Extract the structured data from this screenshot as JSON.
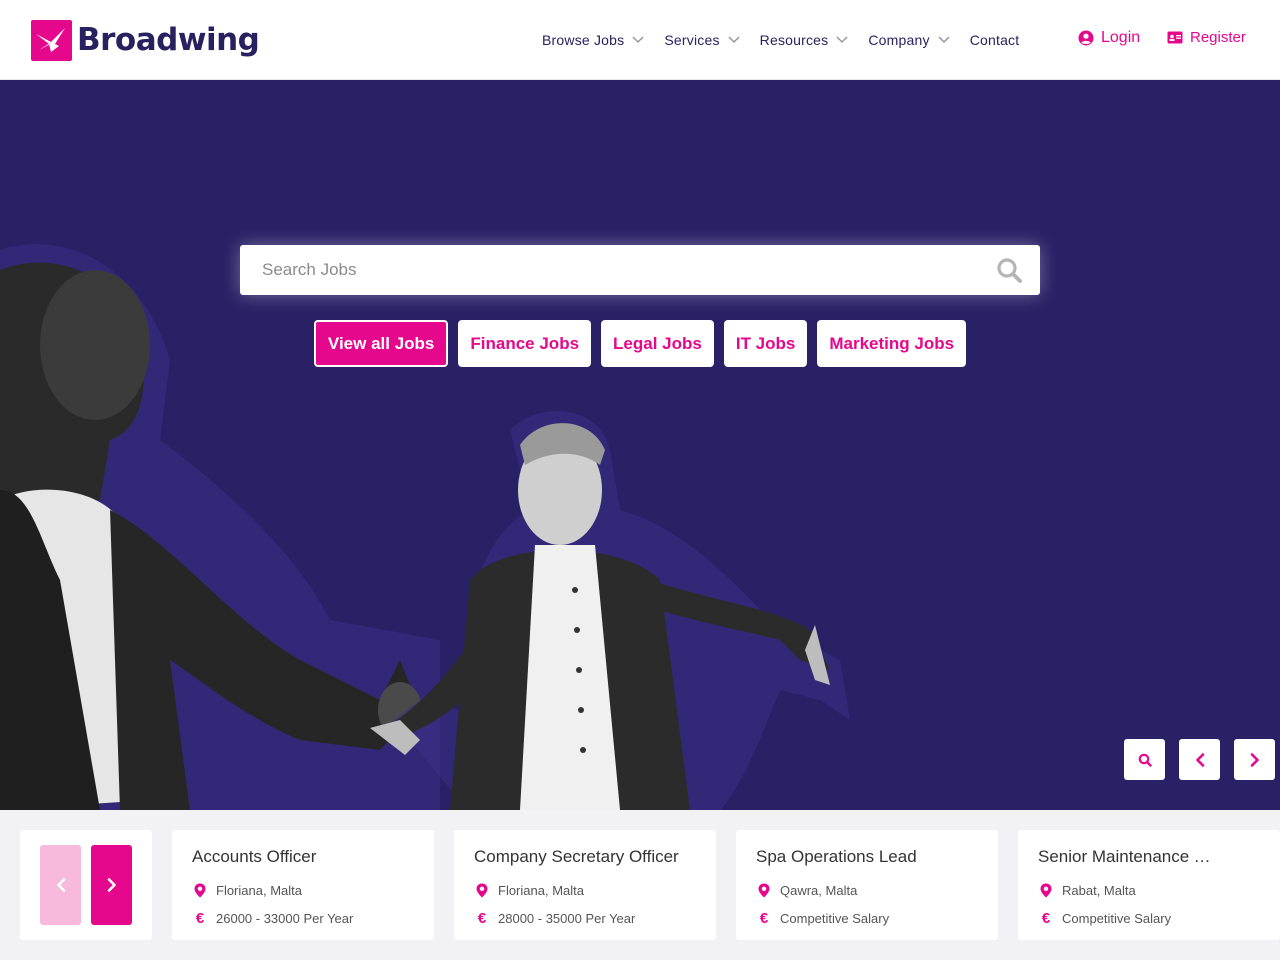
{
  "brand": {
    "name": "Broadwing",
    "accent": "#e5088d",
    "navy": "#27215f",
    "hero_bg": "#2a2066"
  },
  "nav": {
    "items": [
      {
        "label": "Browse Jobs",
        "dropdown": true
      },
      {
        "label": "Services",
        "dropdown": true
      },
      {
        "label": "Resources",
        "dropdown": true
      },
      {
        "label": "Company",
        "dropdown": true
      },
      {
        "label": "Contact",
        "dropdown": false
      }
    ],
    "login": {
      "label": "Login",
      "icon": "user-circle-icon"
    },
    "register": {
      "label": "Register",
      "icon": "id-card-icon"
    }
  },
  "hero": {
    "search": {
      "placeholder": "Search Jobs",
      "icon": "search-icon"
    },
    "tags": [
      {
        "label": "View all Jobs",
        "active": true
      },
      {
        "label": "Finance Jobs",
        "active": false
      },
      {
        "label": "Legal Jobs",
        "active": false
      },
      {
        "label": "IT Jobs",
        "active": false
      },
      {
        "label": "Marketing Jobs",
        "active": false
      }
    ],
    "controls": [
      "search-icon",
      "chevron-left-icon",
      "chevron-right-icon"
    ]
  },
  "jobs": [
    {
      "title": "Accounts Officer",
      "location": "Floriana, Malta",
      "salary": "26000 - 33000 Per Year"
    },
    {
      "title": "Company Secretary Officer",
      "location": "Floriana, Malta",
      "salary": "28000 - 35000 Per Year"
    },
    {
      "title": "Spa Operations Lead",
      "location": "Qawra, Malta",
      "salary": "Competitive Salary"
    },
    {
      "title": "Senior Maintenance Technician",
      "location": "Rabat, Malta",
      "salary": "Competitive Salary"
    }
  ],
  "job_icons": {
    "location": "map-marker-icon",
    "salary": "euro-icon",
    "currency_symbol": "€"
  }
}
